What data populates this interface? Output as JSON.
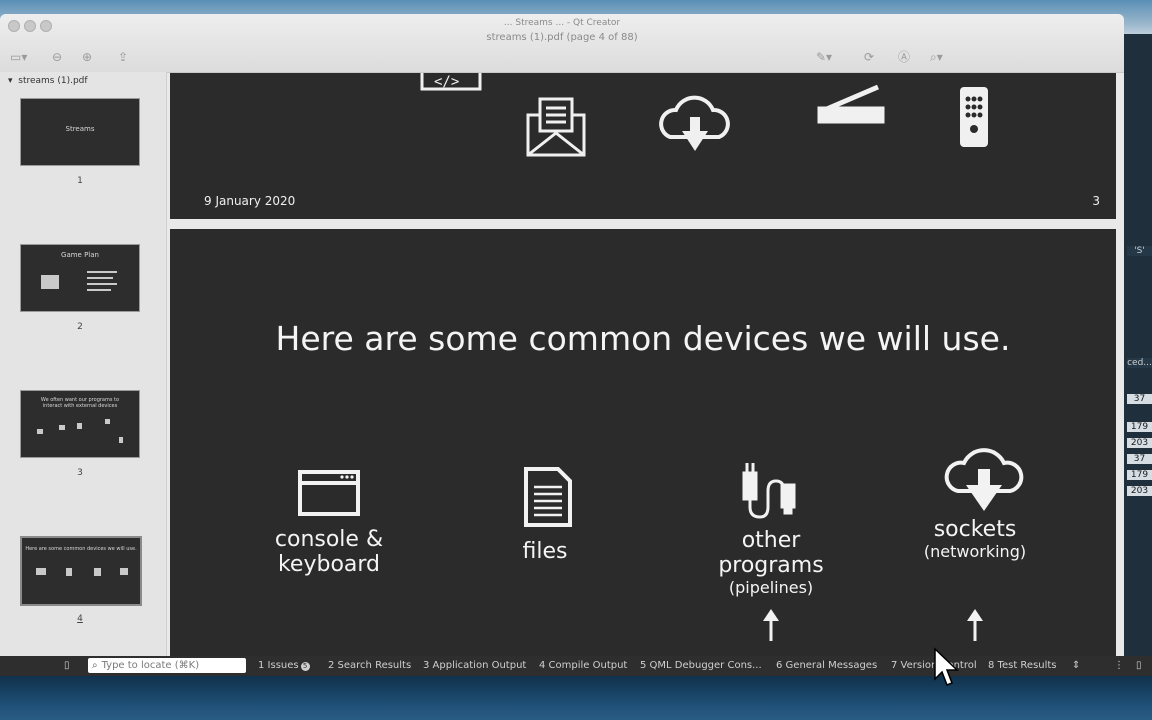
{
  "window": {
    "app_title": "... Streams ... - Qt Creator",
    "doc_title": "streams (1).pdf (page 4 of 88)"
  },
  "sidebar": {
    "file_name": "streams (1).pdf",
    "thumbnails": [
      {
        "page": "1",
        "title": "Streams"
      },
      {
        "page": "2",
        "title": "Game Plan"
      },
      {
        "page": "3",
        "title": "We often want our programs to interact with external devices"
      },
      {
        "page": "4",
        "title": "Here are some common devices we will use."
      }
    ]
  },
  "page3": {
    "date": "9 January 2020",
    "page_number": "3"
  },
  "page4": {
    "title": "Here are some common devices we will use.",
    "devices": [
      {
        "line1": "console &",
        "line2": "keyboard",
        "sub": "",
        "icon": "console-window-icon"
      },
      {
        "line1": "files",
        "line2": "",
        "sub": "",
        "icon": "file-document-icon"
      },
      {
        "line1": "other",
        "line2": "programs",
        "sub": "(pipelines)",
        "icon": "cable-plug-icon"
      },
      {
        "line1": "sockets",
        "line2": "",
        "sub": "(networking)",
        "icon": "cloud-download-icon"
      }
    ]
  },
  "right_strip": {
    "values": [
      "'S'",
      "ced...",
      "37",
      "179",
      "203",
      "37",
      "179",
      "203"
    ]
  },
  "statusbar": {
    "locate_placeholder": "Type to locate (⌘K)",
    "tabs": [
      {
        "label": "1  Issues",
        "badge": "5"
      },
      {
        "label": "2  Search Results"
      },
      {
        "label": "3  Application Output"
      },
      {
        "label": "4  Compile Output"
      },
      {
        "label": "5  QML Debugger Cons..."
      },
      {
        "label": "6  General Messages"
      },
      {
        "label": "7  Version Control"
      },
      {
        "label": "8  Test Results"
      }
    ]
  }
}
